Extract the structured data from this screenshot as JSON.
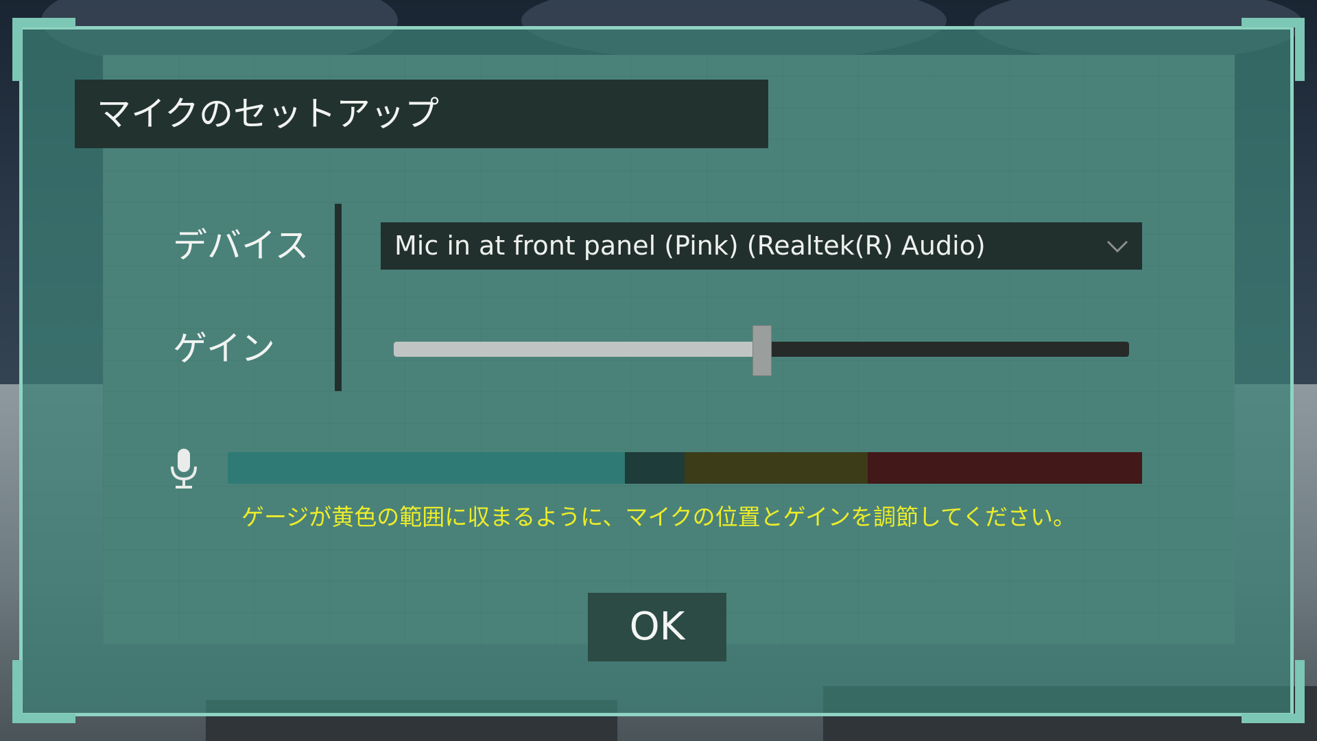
{
  "dialog": {
    "title": "マイクのセットアップ"
  },
  "device": {
    "label": "デバイス",
    "selected": "Mic in at front panel (Pink) (Realtek(R) Audio)",
    "icon": "chevron-down-icon"
  },
  "gain": {
    "label": "ゲイン",
    "value_fraction": 0.5
  },
  "meter": {
    "icon": "microphone-icon",
    "level_fraction": 0.434,
    "zones": [
      {
        "name": "low",
        "fraction": 0.5,
        "color_active": "#2f7a74",
        "color_idle": "#1e3c3a"
      },
      {
        "name": "good",
        "fraction": 0.2,
        "color_active": "#3c3c18",
        "color_idle": "#3c3c18"
      },
      {
        "name": "loud",
        "fraction": 0.3,
        "color_active": "#421818",
        "color_idle": "#421818"
      }
    ]
  },
  "hint": "ゲージが黄色の範囲に収まるように、マイクの位置とゲインを調節してください。",
  "ok_label": "OK",
  "colors": {
    "panel_border": "#8fd3c2",
    "hint_text": "#ecec2a",
    "title_bar": "#22332f"
  }
}
